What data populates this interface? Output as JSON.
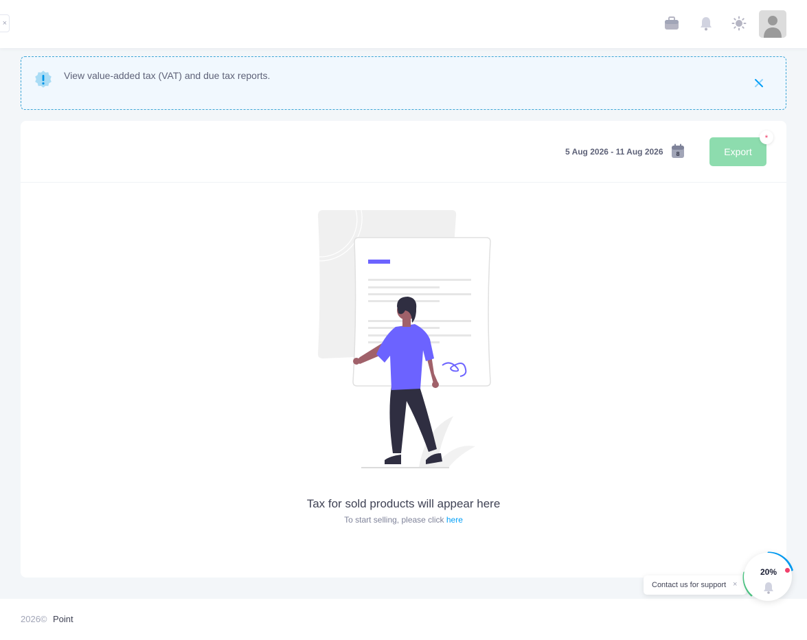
{
  "header": {
    "close_glyph": "×",
    "icons": [
      "briefcase-icon",
      "bell-icon",
      "sun-icon"
    ],
    "avatar": "avatar-placeholder"
  },
  "alert": {
    "text": "View value-added tax (VAT) and due tax reports.",
    "icon": "exclamation-badge-icon",
    "close_icon": "close-icon",
    "colors": {
      "border": "#39a4d6",
      "background": "#f1f8fe"
    }
  },
  "toolbar": {
    "date_range": "5 Aug 2026 - 11 Aug 2026",
    "calendar_day": "8",
    "export_label": "Export",
    "export_badge": "*",
    "colors": {
      "export": "#8ddcae",
      "badge": "#f1416c"
    }
  },
  "empty_state": {
    "title": "Tax for sold products will appear here",
    "subtitle": "To start selling, please click",
    "link": "here",
    "accent": "#6c63ff"
  },
  "footer": {
    "year": "2026©",
    "brand": "Point"
  },
  "support": {
    "label": "Contact us for support",
    "close_glyph": "×",
    "progress_label": "20%",
    "progress_value": 0.2
  }
}
